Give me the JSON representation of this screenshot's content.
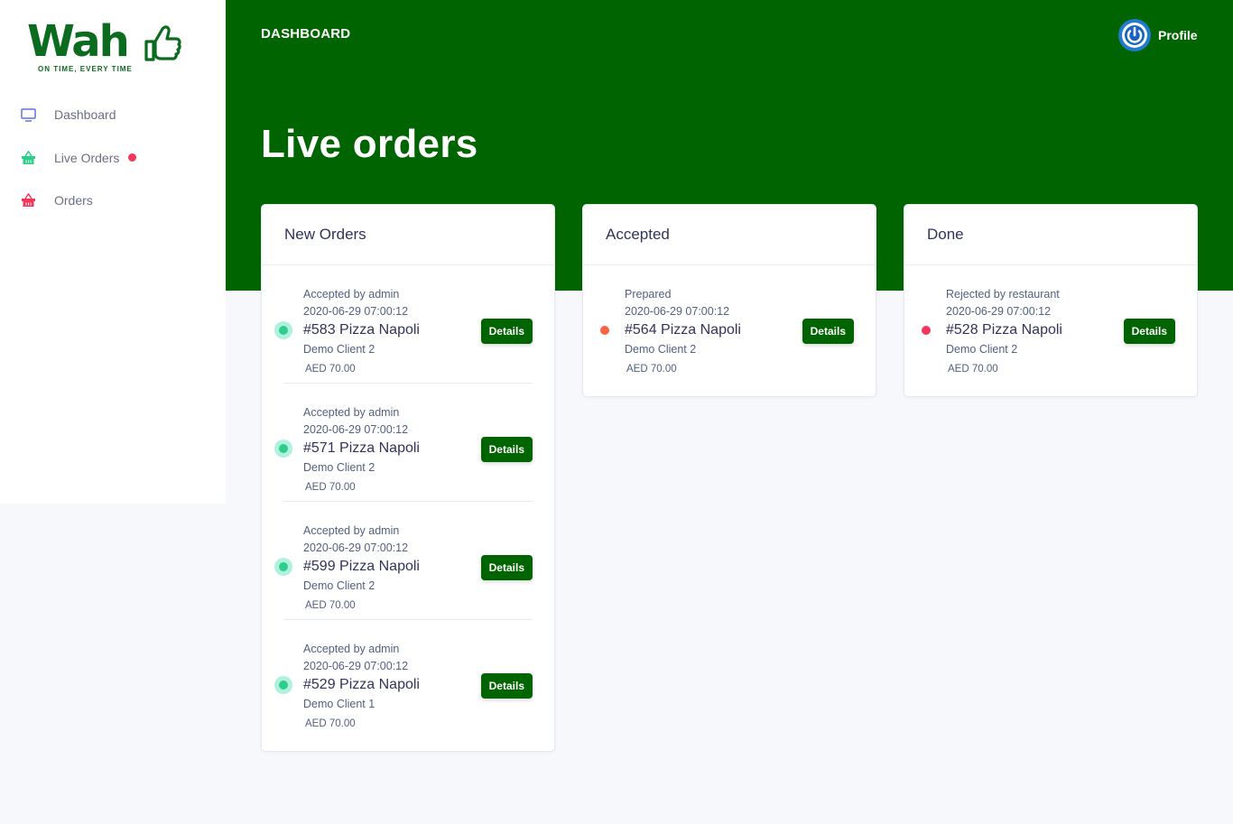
{
  "brand": {
    "name": "Wah",
    "tagline": "ON TIME, EVERY TIME",
    "color": "#0b6b1e"
  },
  "sidebar": {
    "items": [
      {
        "label": "Dashboard",
        "icon": "monitor-icon",
        "color": "#5e72e4"
      },
      {
        "label": "Live Orders",
        "icon": "basket-icon",
        "color": "#2dce89",
        "badge_dot": true
      },
      {
        "label": "Orders",
        "icon": "basket-icon",
        "color": "#f5365c"
      }
    ]
  },
  "header": {
    "breadcrumb": "DASHBOARD",
    "profile_label": "Profile",
    "accent": "#006400"
  },
  "page": {
    "title": "Live orders"
  },
  "columns": [
    {
      "title": "New Orders",
      "orders": [
        {
          "status": "Accepted by admin",
          "time": "2020-06-29 07:00:12",
          "title": "#583 Pizza Napoli",
          "client": "Demo Client 2",
          "price": "AED 70.00",
          "button": "Details"
        },
        {
          "status": "Accepted by admin",
          "time": "2020-06-29 07:00:12",
          "title": "#571 Pizza Napoli",
          "client": "Demo Client 2",
          "price": "AED 70.00",
          "button": "Details"
        },
        {
          "status": "Accepted by admin",
          "time": "2020-06-29 07:00:12",
          "title": "#599 Pizza Napoli",
          "client": "Demo Client 2",
          "price": "AED 70.00",
          "button": "Details"
        },
        {
          "status": "Accepted by admin",
          "time": "2020-06-29 07:00:12",
          "title": "#529 Pizza Napoli",
          "client": "Demo Client 1",
          "price": "AED 70.00",
          "button": "Details"
        }
      ]
    },
    {
      "title": "Accepted",
      "orders": [
        {
          "status": "Prepared",
          "time": "2020-06-29 07:00:12",
          "title": "#564 Pizza Napoli",
          "client": "Demo Client 2",
          "price": "AED 70.00",
          "button": "Details"
        }
      ]
    },
    {
      "title": "Done",
      "orders": [
        {
          "status": "Rejected by restaurant",
          "time": "2020-06-29 07:00:12",
          "title": "#528 Pizza Napoli",
          "client": "Demo Client 2",
          "price": "AED 70.00",
          "button": "Details"
        }
      ]
    }
  ],
  "status_colors": {
    "new": "#2dce89",
    "accepted": "#fb6340",
    "done": "#f5365c"
  }
}
